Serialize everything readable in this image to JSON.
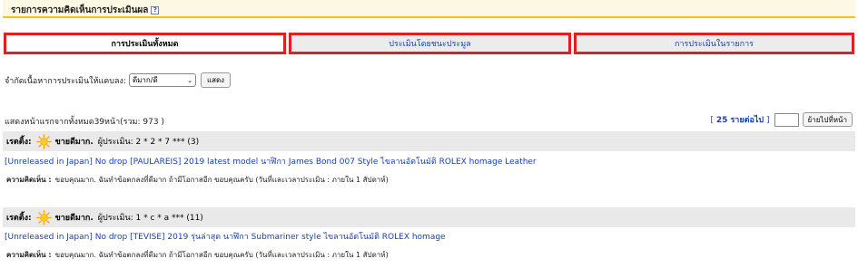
{
  "header": {
    "title": "รายการความคิดเห็นการประเมินผล",
    "help_icon": "?"
  },
  "tabs": [
    {
      "label": "การประเมินทั้งหมด",
      "active": true
    },
    {
      "label": "ประเมินโดยชนะประมูล",
      "active": false
    },
    {
      "label": "การประเมินในรายการ",
      "active": false
    }
  ],
  "filter": {
    "label": "จำกัดเนื้อหาการประเมินให้แคบลง:",
    "selected": "ดีมาก/ดี",
    "button": "แสดง"
  },
  "summary": {
    "text_prefix": "แสดงหน้าแรกจากทั้งหมด39หน้า(รวม: ",
    "total": "973",
    "text_suffix": " )"
  },
  "pager": {
    "bracket_open": "[ ",
    "per_page": "25",
    "per_page_label": " รายต่อไป",
    "bracket_close": " ]",
    "page_input": "",
    "go_button": "ย้ายไปที่หน้า"
  },
  "reviews": [
    {
      "label": "เรตติ้ง:",
      "rating": "ขายดีมาก.",
      "reviewer": "ผู้ประเมิน: 2 * 2 * 7 *** (3)",
      "item": "[Unreleased in Japan] No drop [PAULAREIS] 2019 latest model นาฬิกา James Bond 007 Style ไขลานอัตโนมัติ ROLEX homage Leather",
      "comment_label": "ความคิดเห็น :",
      "comment": "ขอบคุณมาก. ฉันทำข้อตกลงที่ดีมาก ถ้ามีโอกาสอีก ขอบคุณครับ (วันที่และเวลาประเมิน : ภายใน 1 สัปดาห์)"
    },
    {
      "label": "เรตติ้ง:",
      "rating": "ขายดีมาก.",
      "reviewer": "ผู้ประเมิน: 1 * c * a *** (11)",
      "item": "[Unreleased in Japan] No drop [TEVISE] 2019 รุ่นล่าสุด นาฬิกา Submariner style ไขลานอัตโนมัติ ROLEX homage",
      "comment_label": "ความคิดเห็น :",
      "comment": "ขอบคุณมาก. ฉันทำข้อตกลงที่ดีมาก ถ้ามีโอกาสอีก ขอบคุณครับ (วันที่และเวลาประเมิน : ภายใน 1 สัปดาห์)"
    }
  ],
  "colors": {
    "accent": "#f0c419",
    "link": "#1a3fb0",
    "tab_border": "#e02020",
    "row_bg": "#e9e9e9"
  },
  "icons": {
    "help": "help-icon",
    "sun": "sun-icon",
    "chevron": "chevron-down-icon"
  }
}
